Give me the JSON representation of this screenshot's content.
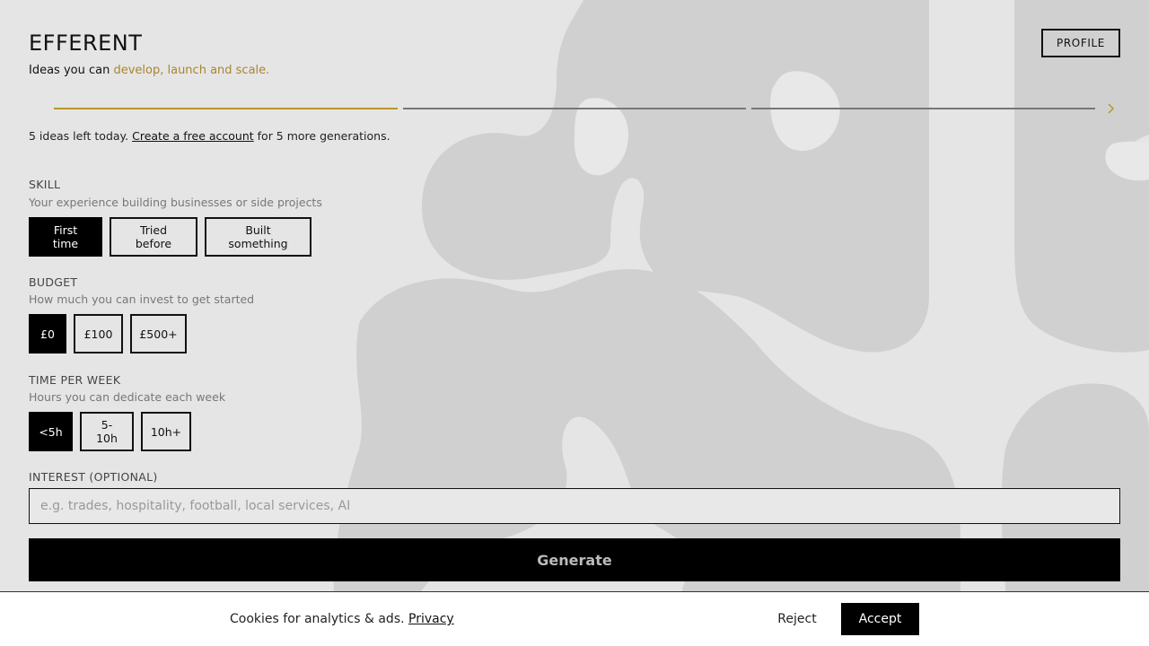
{
  "header": {
    "brand": "EFFERENT",
    "tagline_prefix": "Ideas you can ",
    "tagline_accent": "develop, launch and scale.",
    "profile_label": "PROFILE"
  },
  "progress": {
    "steps": 3,
    "current_step": 1,
    "active_color": "#b9962f",
    "inactive_color": "#777777"
  },
  "quota": {
    "prefix": "5 ideas left today. ",
    "link": "Create a free account",
    "suffix": " for 5 more generations."
  },
  "skill": {
    "title": "SKILL",
    "subtitle": "Your experience building businesses or side projects",
    "options": [
      "First time",
      "Tried before",
      "Built something"
    ],
    "selected": "First time"
  },
  "budget": {
    "title": "BUDGET",
    "subtitle": "How much you can invest to get started",
    "options": [
      "£0",
      "£100",
      "£500+"
    ],
    "selected": "£0"
  },
  "time": {
    "title": "TIME PER WEEK",
    "subtitle": "Hours you can dedicate each week",
    "options": [
      "<5h",
      "5-10h",
      "10h+"
    ],
    "selected": "<5h"
  },
  "interest": {
    "title": "INTEREST (OPTIONAL)",
    "value": "",
    "placeholder": "e.g. trades, hospitality, football, local services, AI"
  },
  "generate_label": "Generate",
  "cookie": {
    "text": "Cookies for analytics & ads. ",
    "privacy_link": "Privacy",
    "reject_label": "Reject",
    "accept_label": "Accept"
  },
  "colors": {
    "background": "#e5e5e5",
    "accent": "#a8862f",
    "blob": "#d0d0d0"
  },
  "icons": {
    "next": "chevron-right-icon"
  }
}
